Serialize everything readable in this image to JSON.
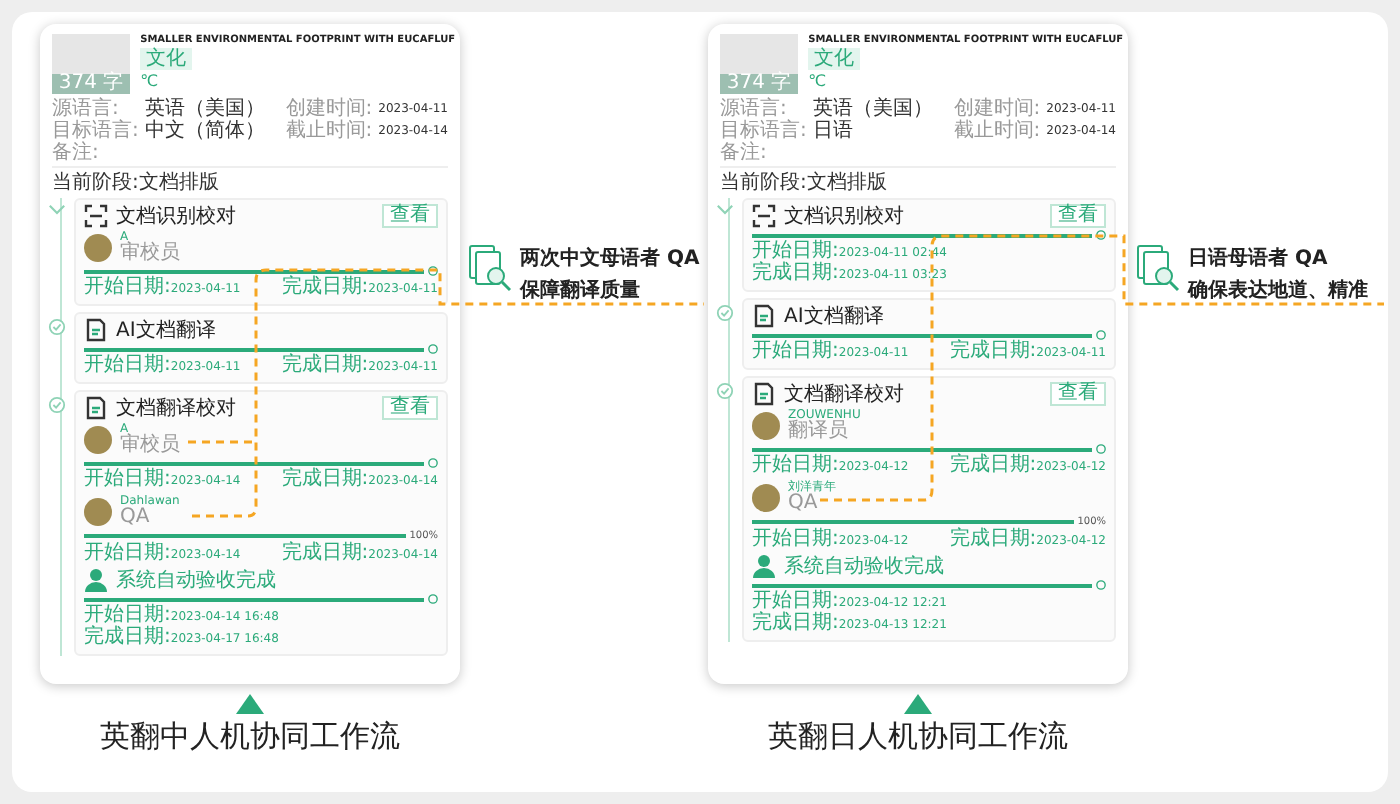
{
  "workflows": [
    {
      "document": {
        "thumbnail_label": "374 字",
        "title": "SMALLER ENVIRONMENTAL FOOTPRINT WITH EUCAFLUF",
        "tag": "文化",
        "unit": "℃"
      },
      "meta": [
        {
          "label": "源语言:",
          "value": "英语（美国）"
        },
        {
          "label": "创建时间:",
          "value": "2023-04-11"
        },
        {
          "label": "目标语言:",
          "value": "中文（简体）"
        },
        {
          "label": "截止时间:",
          "value": "2023-04-14"
        },
        {
          "label": "备注:"
        }
      ],
      "stage_label": "当前阶段:文档排版",
      "stages": [
        {
          "title": "文档识别校对",
          "action": "查看",
          "rows": [
            {
              "kind": "person",
              "name": "A",
              "role": "审校员",
              "level": 1,
              "start_label": "开始日期:",
              "start": "2023-04-11",
              "end_label": "完成日期:",
              "end": "2023-04-11"
            }
          ]
        },
        {
          "title": "AI文档翻译",
          "rows": [
            {
              "kind": "plain",
              "level": 1,
              "start_label": "开始日期:",
              "start": "2023-04-11",
              "end_label": "完成日期:",
              "end": "2023-04-11"
            }
          ]
        },
        {
          "title": "文档翻译校对",
          "action": "查看",
          "rows": [
            {
              "kind": "person",
              "name": "A",
              "role": "审校员",
              "level": 1,
              "start_label": "开始日期:",
              "start": "2023-04-14",
              "end_label": "完成日期:",
              "end": "2023-04-14"
            },
            {
              "kind": "person",
              "name": "Dahlawan",
              "role": "QA",
              "level": 1,
              "reading": "100%",
              "start_label": "开始日期:",
              "start": "2023-04-14",
              "end_label": "完成日期:",
              "end": "2023-04-14"
            },
            {
              "kind": "system",
              "text": "系统自动验收完成",
              "level": 1,
              "start_label": "开始日期:",
              "start": "2023-04-14 16:48",
              "end_label": "完成日期:",
              "end": "2023-04-17 16:48"
            }
          ]
        }
      ],
      "caption": "英翻中人机协同工作流",
      "annotation": {
        "lines": [
          "两次中文母语者 QA",
          "保障翻译质量"
        ]
      }
    },
    {
      "document": {
        "thumbnail_label": "374 字",
        "title": "SMALLER ENVIRONMENTAL FOOTPRINT WITH EUCAFLUF",
        "tag": "文化",
        "unit": "℃"
      },
      "meta": [
        {
          "label": "源语言:",
          "value": "英语（美国）"
        },
        {
          "label": "创建时间:",
          "value": "2023-04-11"
        },
        {
          "label": "目标语言:",
          "value": "日语"
        },
        {
          "label": "截止时间:",
          "value": "2023-04-14"
        },
        {
          "label": "备注:"
        }
      ],
      "stage_label": "当前阶段:文档排版",
      "stages": [
        {
          "title": "文档识别校对",
          "action": "查看",
          "rows": [
            {
              "kind": "plain",
              "level": 1,
              "start_label": "开始日期:",
              "start": "2023-04-11 02:44",
              "end_label": "完成日期:",
              "end": "2023-04-11 03:23"
            }
          ]
        },
        {
          "title": "AI文档翻译",
          "rows": [
            {
              "kind": "plain",
              "level": 1,
              "start_label": "开始日期:",
              "start": "2023-04-11",
              "end_label": "完成日期:",
              "end": "2023-04-11"
            }
          ]
        },
        {
          "title": "文档翻译校对",
          "action": "查看",
          "rows": [
            {
              "kind": "person",
              "name": "ZOUWENHU",
              "role": "翻译员",
              "level": 1,
              "start_label": "开始日期:",
              "start": "2023-04-12",
              "end_label": "完成日期:",
              "end": "2023-04-12"
            },
            {
              "kind": "person",
              "name": "刘洋青年",
              "role": "QA",
              "level": 1,
              "reading": "100%",
              "start_label": "开始日期:",
              "start": "2023-04-12",
              "end_label": "完成日期:",
              "end": "2023-04-12"
            },
            {
              "kind": "system",
              "text": "系统自动验收完成",
              "level": 1,
              "start_label": "开始日期:",
              "start": "2023-04-12 12:21",
              "end_label": "完成日期:",
              "end": "2023-04-13 12:21"
            }
          ]
        }
      ],
      "caption": "英翻日人机协同工作流",
      "annotation": {
        "lines": [
          "日语母语者 QA",
          "确保表达地道、精准"
        ]
      }
    }
  ]
}
